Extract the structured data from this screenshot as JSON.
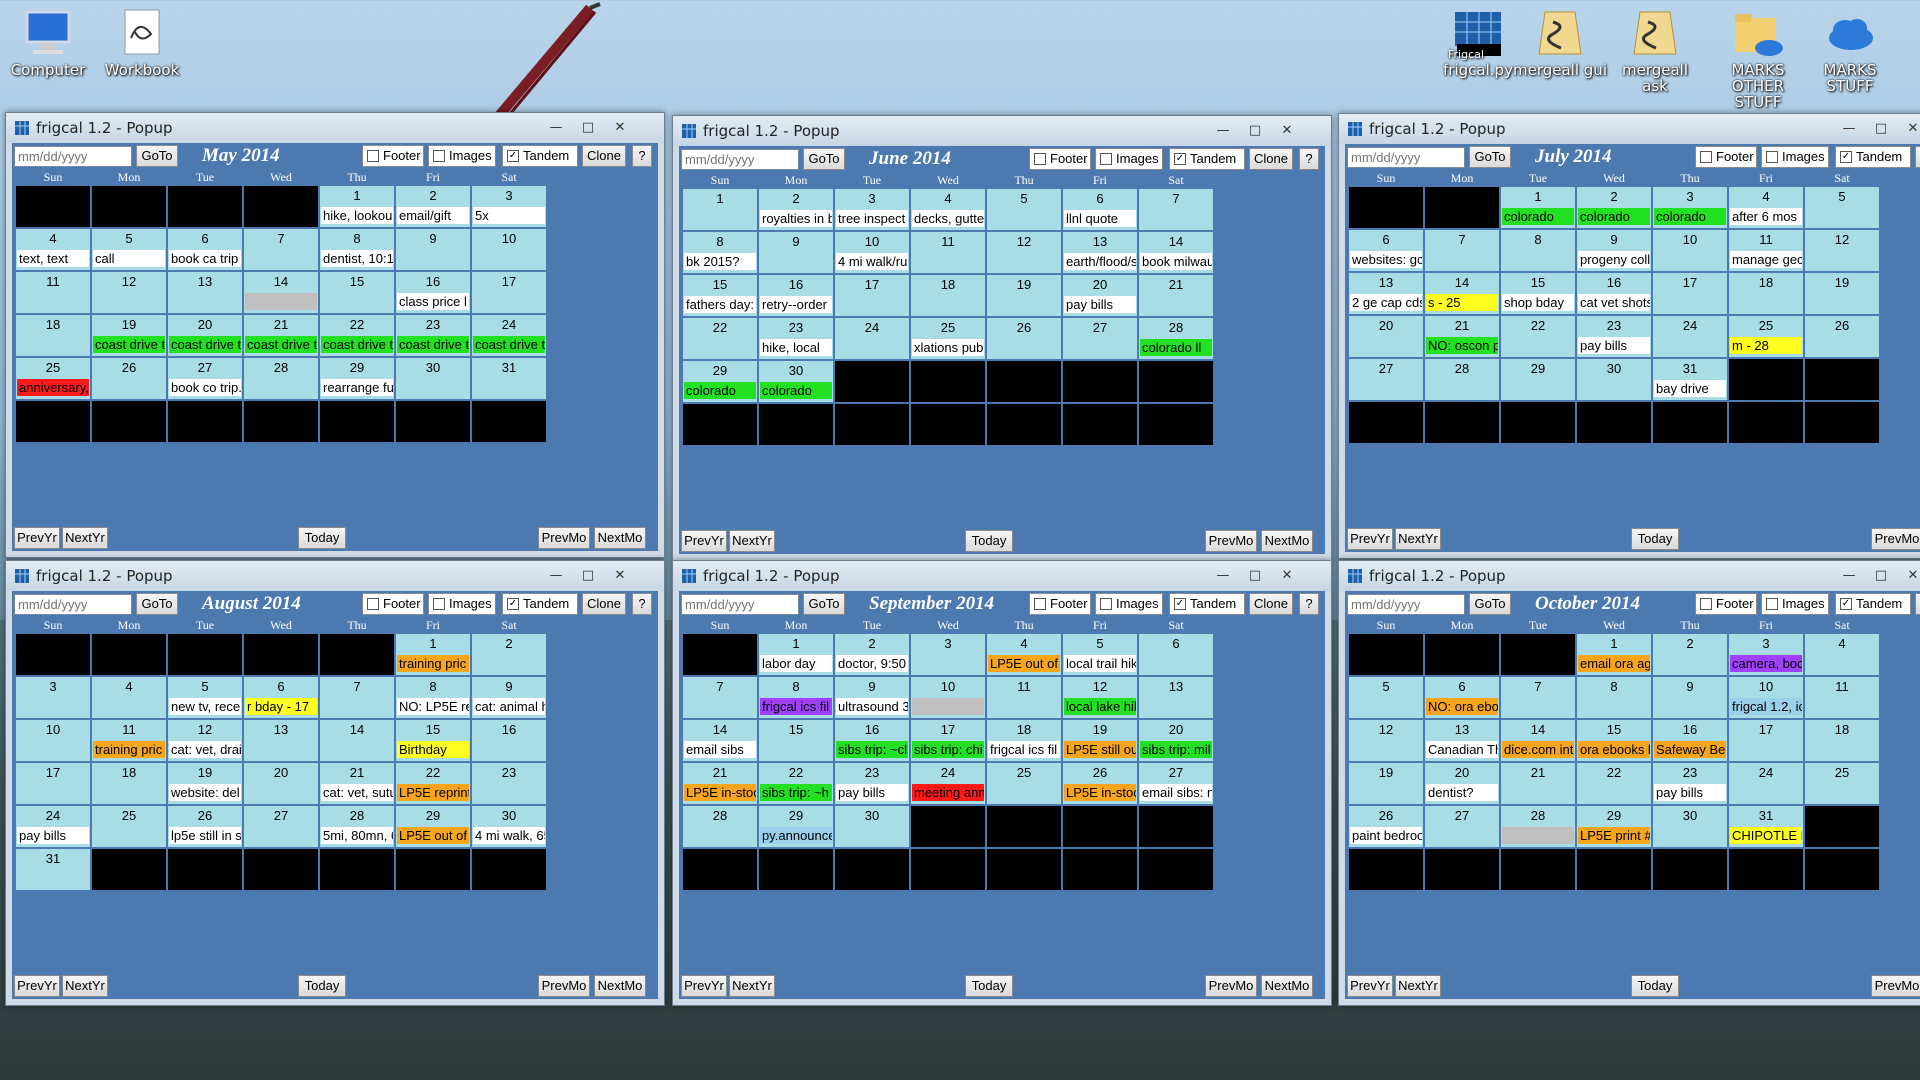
{
  "desktop": {
    "icons": [
      {
        "label": "Computer",
        "icon": "computer-icon"
      },
      {
        "label": "Workbook",
        "icon": "workbook-icon"
      },
      {
        "label": "frigcal.py",
        "icon": "frigcal-icon",
        "overlay": "Frigcal"
      },
      {
        "label": "mergeall gui",
        "icon": "mergeall-icon"
      },
      {
        "label": "mergeall ask",
        "icon": "mergeall-icon"
      },
      {
        "label": "MARKS OTHER STUFF",
        "icon": "folder-cloud-icon"
      },
      {
        "label": "MARKS STUFF",
        "icon": "cloud-icon"
      }
    ]
  },
  "colors": {
    "cell": "#a9dde6",
    "blank": "#000000",
    "header": "#4c7ab0",
    "event_white": "#ffffff",
    "event_green": "#22e022",
    "event_yellow": "#ffff22",
    "event_orange": "#f7a51c",
    "event_red": "#ff1a1a",
    "event_purple": "#a040ff",
    "event_blue": "#9ad0ea",
    "event_gray": "#bfbfbf"
  },
  "common": {
    "title": "frigcal 1.2 - Popup",
    "date_placeholder": "mm/dd/yyyy",
    "goto": "GoTo",
    "footer": "Footer",
    "images": "Images",
    "tandem": "Tandem",
    "clone": "Clone",
    "help": "?",
    "prevyr": "PrevYr",
    "nextyr": "NextYr",
    "today": "Today",
    "prevmo": "PrevMo",
    "nextmo": "NextMo",
    "days": [
      "Sun",
      "Mon",
      "Tue",
      "Wed",
      "Thu",
      "Fri",
      "Sat"
    ],
    "minimize": "—",
    "maximize": "□",
    "close": "✕"
  },
  "calendars": [
    {
      "month": "May 2014",
      "first_dow": 4,
      "num_days": 31,
      "events": {
        "1": [
          "hike, lookou",
          "white"
        ],
        "2": [
          "email/gift",
          "white"
        ],
        "3": [
          "5x",
          "white"
        ],
        "4": [
          "text, text",
          "white"
        ],
        "5": [
          "call",
          "white"
        ],
        "6": [
          "book ca trip",
          "white"
        ],
        "8": [
          "dentist, 10:1",
          "white"
        ],
        "14": [
          "",
          "gray"
        ],
        "16": [
          "class price l",
          "white"
        ],
        "19": [
          "coast drive t",
          "green"
        ],
        "20": [
          "coast drive t",
          "green"
        ],
        "21": [
          "coast drive t",
          "green"
        ],
        "22": [
          "coast drive t",
          "green"
        ],
        "23": [
          "coast drive t",
          "green"
        ],
        "24": [
          "coast drive t",
          "green"
        ],
        "25": [
          "anniversary,",
          "red"
        ],
        "27": [
          "book co trip.",
          "white"
        ],
        "29": [
          "rearrange fu",
          "white"
        ]
      }
    },
    {
      "month": "June 2014",
      "first_dow": 0,
      "num_days": 30,
      "events": {
        "2": [
          "royalties in b",
          "white"
        ],
        "3": [
          "tree inspect",
          "white"
        ],
        "4": [
          "decks, gutte",
          "white"
        ],
        "6": [
          "llnl quote",
          "white"
        ],
        "8": [
          "bk 2015?",
          "white"
        ],
        "10": [
          "4 mi walk/rur",
          "white"
        ],
        "13": [
          "earth/flood/s",
          "white"
        ],
        "14": [
          "book milwau",
          "white"
        ],
        "15": [
          "fathers day:",
          "white"
        ],
        "16": [
          "retry--order",
          "white"
        ],
        "20": [
          "pay bills",
          "white"
        ],
        "23": [
          "hike, local",
          "white"
        ],
        "25": [
          "xlations pub",
          "white"
        ],
        "28": [
          "colorado ll",
          "green"
        ],
        "29": [
          "colorado",
          "green"
        ],
        "30": [
          "colorado",
          "green"
        ]
      }
    },
    {
      "month": "July 2014",
      "first_dow": 2,
      "num_days": 31,
      "events": {
        "1": [
          "colorado",
          "green"
        ],
        "2": [
          "colorado",
          "green"
        ],
        "3": [
          "colorado",
          "green"
        ],
        "4": [
          "after 6 mos",
          "white"
        ],
        "6": [
          "websites: gc",
          "white"
        ],
        "9": [
          "progeny coll",
          "white"
        ],
        "11": [
          "manage gec",
          "white"
        ],
        "13": [
          "2 ge cap cds",
          "white"
        ],
        "14": [
          "s - 25",
          "yellow"
        ],
        "15": [
          "shop bday",
          "white"
        ],
        "16": [
          "cat vet shots",
          "white"
        ],
        "21": [
          "NO: oscon p",
          "green"
        ],
        "23": [
          "pay bills",
          "white"
        ],
        "25": [
          "m - 28",
          "yellow"
        ],
        "31": [
          "bay drive",
          "white"
        ]
      }
    },
    {
      "month": "August 2014",
      "first_dow": 5,
      "num_days": 31,
      "events": {
        "1": [
          "training pric",
          "orange"
        ],
        "5": [
          "new tv, rece",
          "white"
        ],
        "6": [
          "r bday - 17",
          "yellow"
        ],
        "8": [
          "NO: LP5E re",
          "white"
        ],
        "9": [
          "cat: animal h",
          "white"
        ],
        "11": [
          "training pric",
          "orange"
        ],
        "12": [
          "cat: vet, drai",
          "white"
        ],
        "15": [
          "Birthday",
          "yellow"
        ],
        "19": [
          "website: del",
          "white"
        ],
        "21": [
          "cat: vet, sutu",
          "white"
        ],
        "22": [
          "LP5E reprint",
          "orange"
        ],
        "24": [
          "pay bills",
          "white"
        ],
        "26": [
          "lp5e still in s",
          "white"
        ],
        "28": [
          "5mi, 80mn, 6",
          "white"
        ],
        "29": [
          "LP5E out of",
          "orange"
        ],
        "30": [
          "4 mi walk, 65",
          "white"
        ]
      }
    },
    {
      "month": "September 2014",
      "first_dow": 1,
      "num_days": 30,
      "events": {
        "1": [
          "labor day",
          "white"
        ],
        "2": [
          "doctor, 9:50",
          "white"
        ],
        "4": [
          "LP5E out of",
          "orange"
        ],
        "5": [
          "local trail hik",
          "white"
        ],
        "8": [
          "frigcal ics fil",
          "purple"
        ],
        "9": [
          "ultrasound 3",
          "white"
        ],
        "10": [
          "",
          "gray"
        ],
        "12": [
          "local lake hil",
          "green"
        ],
        "14": [
          "email sibs",
          "white"
        ],
        "16": [
          "sibs trip: ~cl",
          "green"
        ],
        "17": [
          "sibs trip: chi",
          "green"
        ],
        "18": [
          "frigcal ics fil",
          "white"
        ],
        "19": [
          "LP5E still ou",
          "orange"
        ],
        "20": [
          "sibs trip: mil",
          "green"
        ],
        "21": [
          "LP5E in-stoc",
          "orange"
        ],
        "22": [
          "sibs trip: ~h",
          "green"
        ],
        "23": [
          "pay bills",
          "white"
        ],
        "24": [
          "meeting ann",
          "red"
        ],
        "26": [
          "LP5E in-stoc",
          "orange"
        ],
        "27": [
          "email sibs: n",
          "white"
        ],
        "29": [
          "py.announce",
          "blue"
        ]
      }
    },
    {
      "month": "October 2014",
      "first_dow": 3,
      "num_days": 31,
      "events": {
        "1": [
          "email ora ag",
          "orange"
        ],
        "3": [
          "camera, boo",
          "purple"
        ],
        "6": [
          "NO: ora ebo",
          "orange"
        ],
        "10": [
          "frigcal 1.2, ic",
          "blue"
        ],
        "13": [
          "Canadian Th",
          "white"
        ],
        "14": [
          "dice.com int",
          "orange"
        ],
        "15": [
          "ora ebooks l",
          "orange"
        ],
        "16": [
          "Safeway Bel",
          "orange"
        ],
        "20": [
          "dentist?",
          "white"
        ],
        "23": [
          "pay bills",
          "white"
        ],
        "26": [
          "paint bedroo",
          "white"
        ],
        "28": [
          "",
          "gray"
        ],
        "29": [
          "LP5E print #",
          "orange"
        ],
        "31": [
          "CHIPOTLE E",
          "yellow"
        ]
      }
    }
  ]
}
